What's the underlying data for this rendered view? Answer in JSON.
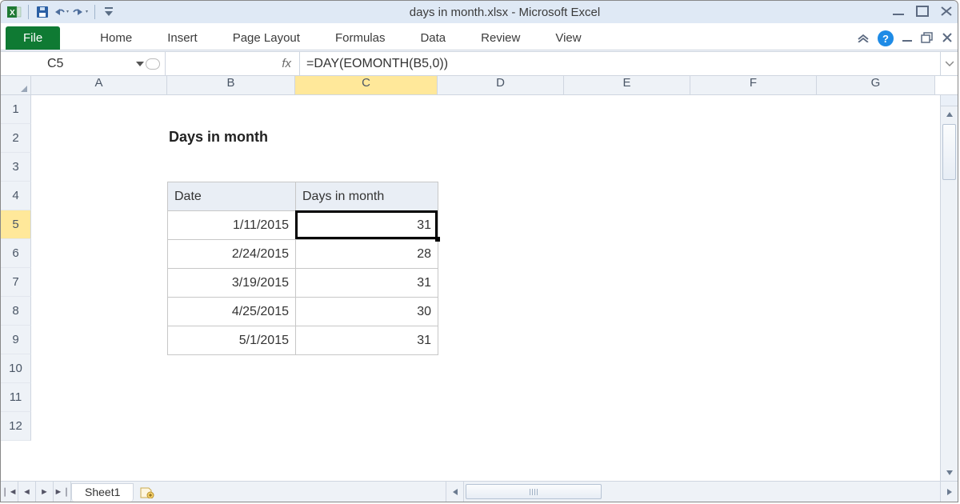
{
  "window": {
    "title": "days in month.xlsx  -  Microsoft Excel"
  },
  "ribbon": {
    "file": "File",
    "tabs": [
      "Home",
      "Insert",
      "Page Layout",
      "Formulas",
      "Data",
      "Review",
      "View"
    ]
  },
  "namebox": "C5",
  "fx_label": "fx",
  "formula": "=DAY(EOMONTH(B5,0))",
  "columns": [
    "A",
    "B",
    "C",
    "D",
    "E",
    "F",
    "G"
  ],
  "rows": [
    "1",
    "2",
    "3",
    "4",
    "5",
    "6",
    "7",
    "8",
    "9",
    "10",
    "11",
    "12"
  ],
  "active_col": "C",
  "active_row": "5",
  "section_title": "Days in month",
  "table": {
    "headers": [
      "Date",
      "Days in month"
    ],
    "rows": [
      {
        "date": "1/11/2015",
        "days": "31"
      },
      {
        "date": "2/24/2015",
        "days": "28"
      },
      {
        "date": "3/19/2015",
        "days": "31"
      },
      {
        "date": "4/25/2015",
        "days": "30"
      },
      {
        "date": "5/1/2015",
        "days": "31"
      }
    ]
  },
  "sheet_tab": "Sheet1"
}
